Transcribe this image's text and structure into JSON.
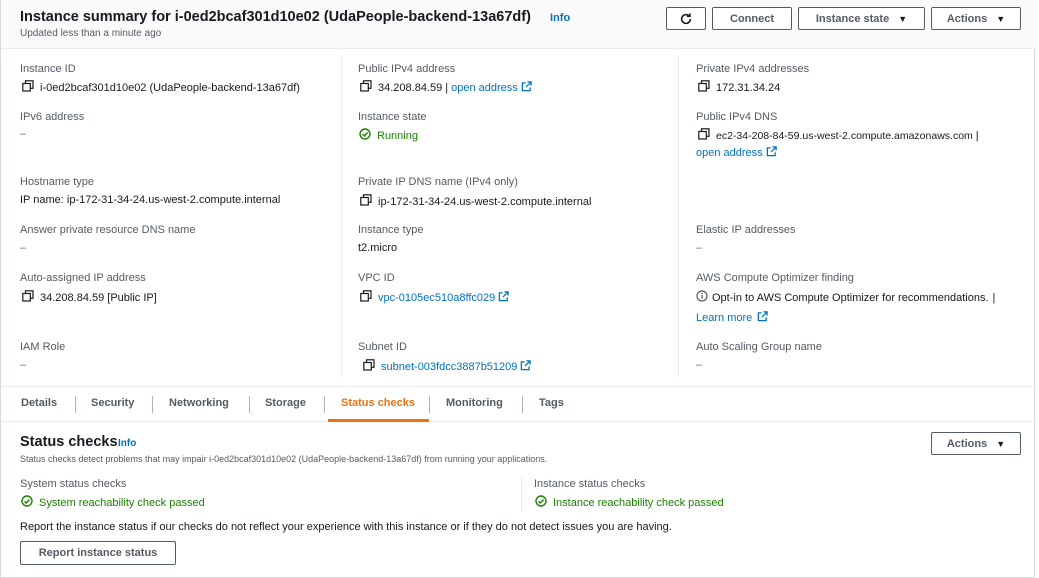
{
  "header": {
    "title": "Instance summary for i-0ed2bcaf301d10e02 (UdaPeople-backend-13a67df)",
    "info": "Info",
    "updated": "Updated less than a minute ago",
    "buttons": {
      "connect": "Connect",
      "instance_state": "Instance state",
      "actions": "Actions"
    }
  },
  "details": {
    "instance_id": {
      "label": "Instance ID",
      "value": "i-0ed2bcaf301d10e02 (UdaPeople-backend-13a67df)"
    },
    "public_ipv4": {
      "label": "Public IPv4 address",
      "value": "34.208.84.59",
      "sep": "|",
      "link": "open address"
    },
    "private_ipv4": {
      "label": "Private IPv4 addresses",
      "value": "172.31.34.24"
    },
    "ipv6": {
      "label": "IPv6 address",
      "value": "–"
    },
    "instance_state": {
      "label": "Instance state",
      "value": "Running"
    },
    "public_dns": {
      "label": "Public IPv4 DNS",
      "value": "ec2-34-208-84-59.us-west-2.compute.amazonaws.com",
      "sep": "|",
      "link": "open address"
    },
    "hostname_type": {
      "label": "Hostname type",
      "value": "IP name: ip-172-31-34-24.us-west-2.compute.internal"
    },
    "private_dns": {
      "label": "Private IP DNS name (IPv4 only)",
      "value": "ip-172-31-34-24.us-west-2.compute.internal"
    },
    "answer_dns": {
      "label": "Answer private resource DNS name",
      "value": "–"
    },
    "instance_type": {
      "label": "Instance type",
      "value": "t2.micro"
    },
    "elastic_ip": {
      "label": "Elastic IP addresses",
      "value": "–"
    },
    "auto_ip": {
      "label": "Auto-assigned IP address",
      "value": "34.208.84.59 [Public IP]"
    },
    "vpc": {
      "label": "VPC ID",
      "value": "vpc-0105ec510a8ffc029"
    },
    "optimizer": {
      "label": "AWS Compute Optimizer finding",
      "value": "Opt-in to AWS Compute Optimizer for recommendations.",
      "sep": "|",
      "link": "Learn more"
    },
    "iam_role": {
      "label": "IAM Role",
      "value": "–"
    },
    "subnet": {
      "label": "Subnet ID",
      "value": "subnet-003fdcc3887b51209"
    },
    "asg": {
      "label": "Auto Scaling Group name",
      "value": "–"
    }
  },
  "tabs": [
    "Details",
    "Security",
    "Networking",
    "Storage",
    "Status checks",
    "Monitoring",
    "Tags"
  ],
  "active_tab": "Status checks",
  "status_checks": {
    "title": "Status checks",
    "info": "Info",
    "actions": "Actions",
    "description": "Status checks detect problems that may impair i-0ed2bcaf301d10e02 (UdaPeople-backend-13a67df) from running your applications.",
    "system": {
      "label": "System status checks",
      "value": "System reachability check passed"
    },
    "instance": {
      "label": "Instance status checks",
      "value": "Instance reachability check passed"
    },
    "note": "Report the instance status if our checks do not reflect your experience with this instance or if they do not detect issues you are having.",
    "report_button": "Report instance status"
  },
  "colors": {
    "link": "#0073bb",
    "success": "#1d8102",
    "active_tab": "#ec7211",
    "text": "#16191f",
    "muted": "#545b64"
  }
}
